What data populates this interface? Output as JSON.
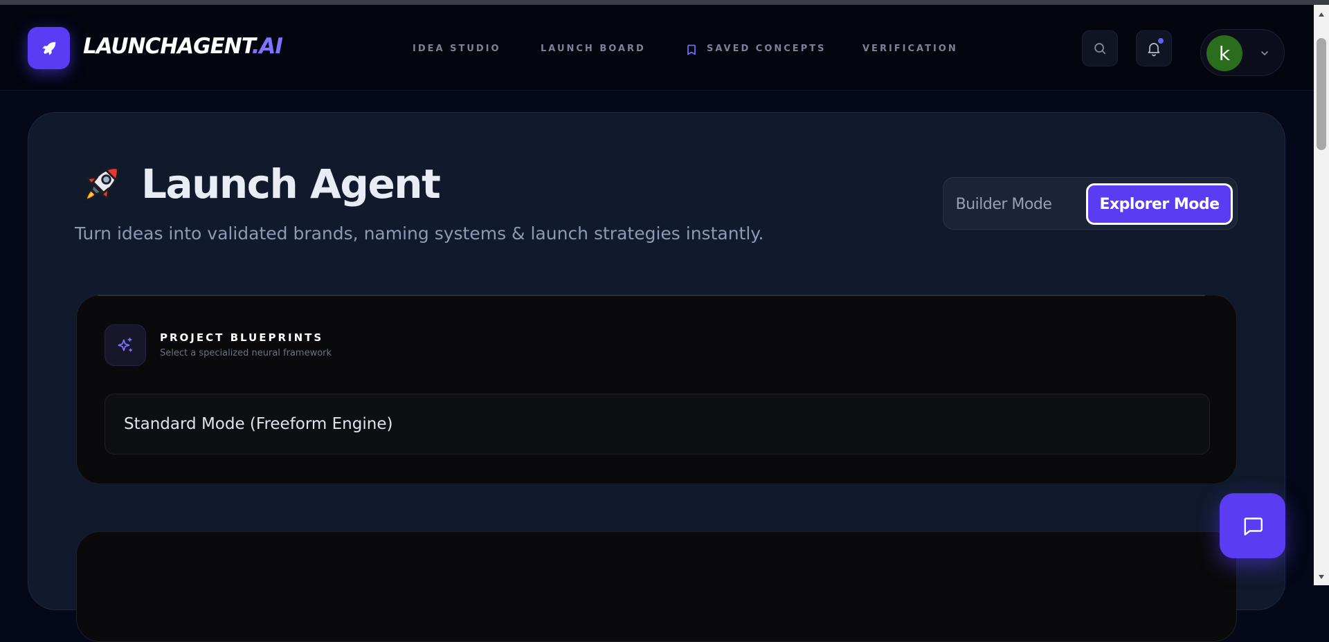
{
  "header": {
    "brand_main": "LAUNCHAGENT",
    "brand_accent": ".AI",
    "nav": [
      {
        "label": "IDEA STUDIO"
      },
      {
        "label": "LAUNCH BOARD"
      },
      {
        "label": "SAVED CONCEPTS"
      },
      {
        "label": "VERIFICATION"
      }
    ],
    "avatar_initial": "k"
  },
  "hero": {
    "title": "Launch Agent",
    "subtitle": "Turn ideas into validated brands, naming systems & launch strategies instantly."
  },
  "mode_toggle": {
    "builder_label": "Builder Mode",
    "explorer_label": "Explorer Mode",
    "selected": "Explorer Mode"
  },
  "blueprints": {
    "title": "PROJECT BLUEPRINTS",
    "subtitle": "Select a specialized neural framework",
    "selected_value": "Standard Mode (Freeform Engine)"
  },
  "colors": {
    "accent": "#5a3cf2",
    "brand_accent_text": "#7f73ff",
    "page_bg": "#050818",
    "card_bg": "#111a2c",
    "panel_bg": "#0a0a0c",
    "avatar_bg": "#2a6e1d"
  },
  "icons": {
    "logo": "rocket-icon",
    "nav_saved": "bookmark-icon",
    "search": "search-icon",
    "notifications": "bell-icon",
    "profile_menu": "chevron-down-icon",
    "blueprints": "sparkles-icon",
    "chat": "chat-bubble-icon"
  }
}
